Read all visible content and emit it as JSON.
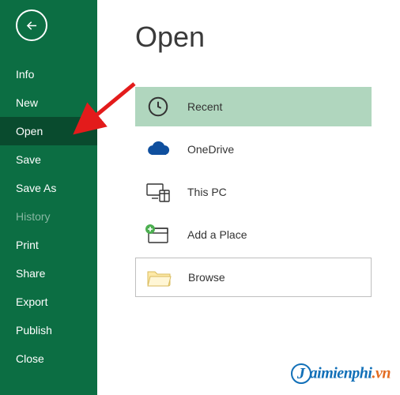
{
  "sidebar": {
    "items": [
      {
        "label": "Info"
      },
      {
        "label": "New"
      },
      {
        "label": "Open",
        "selected": true
      },
      {
        "label": "Save"
      },
      {
        "label": "Save As"
      },
      {
        "label": "History",
        "faded": true
      },
      {
        "label": "Print"
      },
      {
        "label": "Share"
      },
      {
        "label": "Export"
      },
      {
        "label": "Publish"
      },
      {
        "label": "Close"
      }
    ]
  },
  "page_title": "Open",
  "options": {
    "recent": "Recent",
    "onedrive": "OneDrive",
    "thispc": "This PC",
    "addplace": "Add a Place",
    "browse": "Browse"
  },
  "watermark": {
    "brand": "aimienphi",
    "ext": ".vn"
  },
  "colors": {
    "sidebar": "#0c6e43",
    "sidebar_selected": "#094b2e",
    "option_selected": "#b0d6be",
    "onedrive_blue": "#0f4f9e",
    "arrow_red": "#e31b1b"
  }
}
